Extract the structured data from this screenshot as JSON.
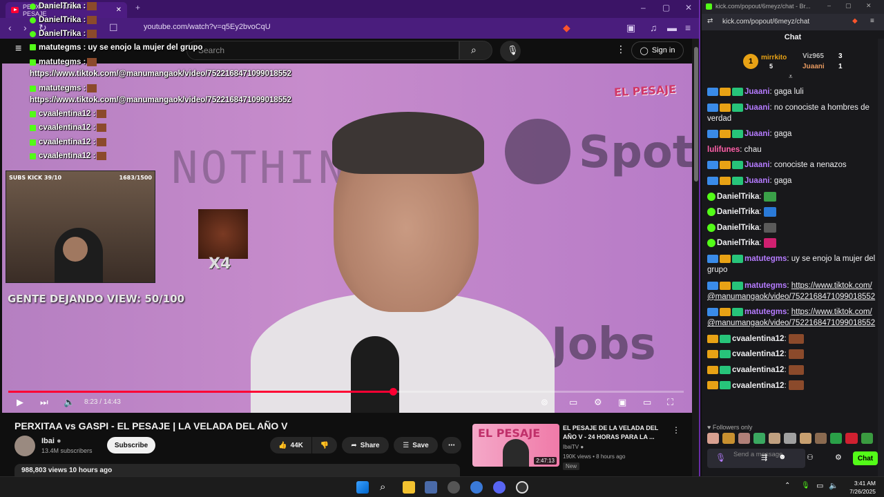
{
  "youtube": {
    "tab_title": "PERXITAA vs GASPI - EL PESAJE",
    "url": "youtube.com/watch?v=q5Ey2bvoCqU",
    "search_placeholder": "Search",
    "sign_in": "Sign in",
    "video": {
      "current_time": "8:23",
      "duration": "14:43",
      "progress_fraction": 0.57,
      "overlay_subs": "SUBS KICK 39/10",
      "overlay_count": "1683/1500",
      "overlay_emote": "X4",
      "overlay_gente": "GENTE DEJANDO VIEW: 50/100",
      "overlay_logo": "EL PESAJE",
      "bg_text_1": "NOTHIN",
      "bg_text_2": "Spoti",
      "bg_text_3": "Jobs"
    },
    "title": "PERXITAA vs GASPI - EL PESAJE | LA VELADA DEL AÑO V",
    "channel": {
      "name": "Ibai",
      "subscribers": "13.4M subscribers",
      "subscribe": "Subscribe"
    },
    "actions": {
      "likes": "44K",
      "share": "Share",
      "save": "Save"
    },
    "views": "988,803 views  10 hours ago",
    "recommended": {
      "title": "EL PESAJE DE LA VELADA DEL AÑO V - 24 HORAS PARA LA ...",
      "channel": "IbaiTV",
      "meta": "190K views • 8 hours ago",
      "badge": "New",
      "duration": "2:47:13",
      "thumb_text": "EL PESAJE"
    }
  },
  "overlay_chat": [
    {
      "user": "DanielTrika :",
      "text": ""
    },
    {
      "user": "DanielTrika :",
      "text": ""
    },
    {
      "user": "DanielTrika :",
      "text": ""
    },
    {
      "user": "matutegms :",
      "text": "uy se enojo la mujer del grupo"
    },
    {
      "user": "matutegms :",
      "text": ""
    },
    {
      "user": "",
      "text": "https://www.tiktok.com/@manumangaok/video/7522168471099018552"
    },
    {
      "user": "matutegms :",
      "text": ""
    },
    {
      "user": "",
      "text": "https://www.tiktok.com/@manumangaok/video/7522168471099018552"
    },
    {
      "user": "cvaalentina12 :",
      "text": ""
    },
    {
      "user": "cvaalentina12 :",
      "text": ""
    },
    {
      "user": "cvaalentina12 :",
      "text": ""
    },
    {
      "user": "cvaalentina12 :",
      "text": ""
    }
  ],
  "kick": {
    "tab_title": "kick.com/popout/6meyz/chat - Br...",
    "url": "kick.com/popout/6meyz/chat",
    "header": "Chat",
    "leaderboard": {
      "first_rank": "1",
      "first_name": "mirrkito",
      "first_count": "5",
      "second_name": "Viz965",
      "second_count": "3",
      "third_name": "Juaani",
      "third_count": "1"
    },
    "messages": [
      {
        "user": "Juaani",
        "color": "#b57bff",
        "text": "gaga luli",
        "badges": "acs"
      },
      {
        "user": "Juaani",
        "color": "#b57bff",
        "text": "no conociste a hombres de verdad",
        "badges": "acs"
      },
      {
        "user": "Juaani",
        "color": "#b57bff",
        "text": "gaga",
        "badges": "acs"
      },
      {
        "user": "lulifunes",
        "color": "#ff5fa8",
        "text": "chau",
        "badges": ""
      },
      {
        "user": "Juaani",
        "color": "#b57bff",
        "text": "conociste a nenazos",
        "badges": "acs"
      },
      {
        "user": "Juaani",
        "color": "#b57bff",
        "text": "gaga",
        "badges": "acs"
      },
      {
        "user": "DanielTrika",
        "color": "#efeff1",
        "text": "",
        "badges": "v"
      },
      {
        "user": "DanielTrika",
        "color": "#efeff1",
        "text": "",
        "badges": "v"
      },
      {
        "user": "DanielTrika",
        "color": "#efeff1",
        "text": "",
        "badges": "v"
      },
      {
        "user": "DanielTrika",
        "color": "#efeff1",
        "text": "",
        "badges": "v"
      },
      {
        "user": "matutegms",
        "color": "#b57bff",
        "text": "uy se enojo la mujer del grupo",
        "badges": "acs"
      },
      {
        "user": "matutegms",
        "color": "#b57bff",
        "text": "https://www.tiktok.com/@manumangaok/video/7522168471099018552",
        "badges": "acs"
      },
      {
        "user": "matutegms",
        "color": "#b57bff",
        "text": "https://www.tiktok.com/@manumangaok/video/7522168471099018552",
        "badges": "acs"
      },
      {
        "user": "cvaalentina12",
        "color": "#efeff1",
        "text": "",
        "badges": "cs"
      },
      {
        "user": "cvaalentina12",
        "color": "#efeff1",
        "text": "",
        "badges": "cs"
      },
      {
        "user": "cvaalentina12",
        "color": "#efeff1",
        "text": "",
        "badges": "cs"
      },
      {
        "user": "cvaalentina12",
        "color": "#efeff1",
        "text": "",
        "badges": "cs"
      }
    ],
    "followers_only": "Followers only",
    "input_placeholder": "Send a message",
    "chat_button": "Chat",
    "accent": "#53fc18"
  },
  "taskbar": {
    "time": "3:41 AM",
    "date": "7/26/2025"
  }
}
